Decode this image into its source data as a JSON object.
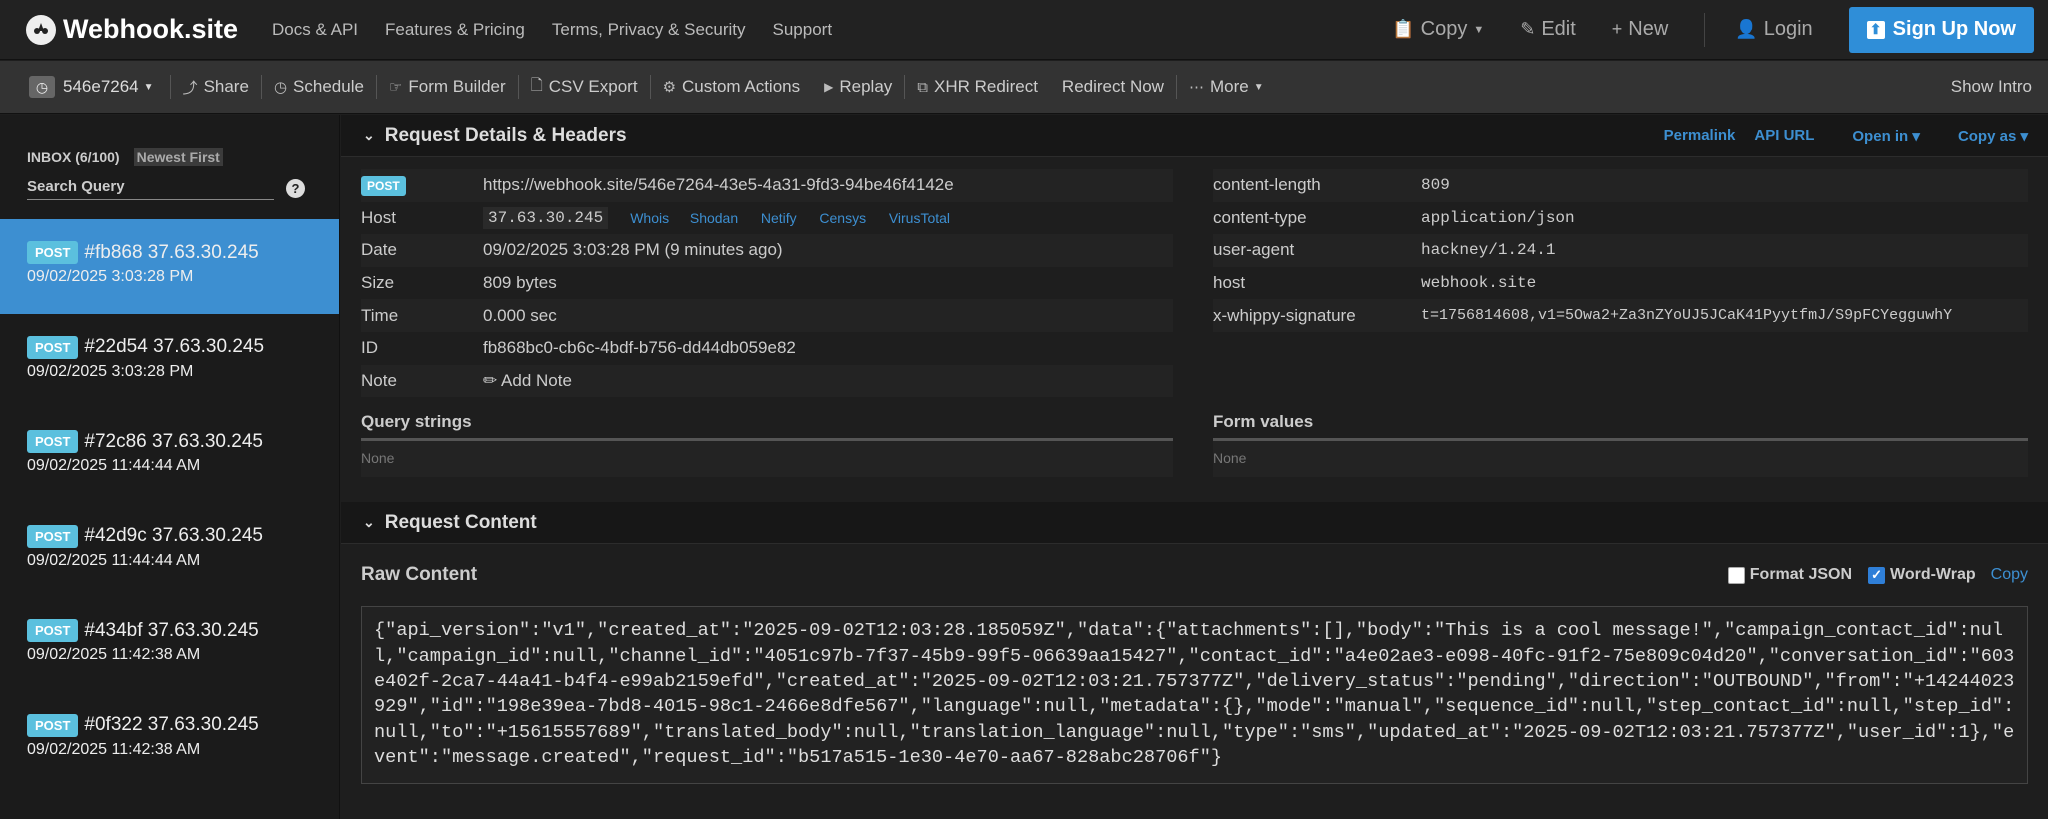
{
  "nav": {
    "brand": "Webhook.site",
    "links": [
      "Docs & API",
      "Features & Pricing",
      "Terms, Privacy & Security",
      "Support"
    ],
    "copy_label": "Copy",
    "edit_label": "Edit",
    "new_label": "New",
    "login_label": "Login",
    "signup_label": "Sign Up Now"
  },
  "toolbar": {
    "token": "546e7264",
    "share": "Share",
    "schedule": "Schedule",
    "form_builder": "Form Builder",
    "csv_export": "CSV Export",
    "custom_actions": "Custom Actions",
    "replay": "Replay",
    "xhr_redirect": "XHR Redirect",
    "redirect_now": "Redirect Now",
    "more": "More",
    "show_intro": "Show Intro"
  },
  "sidebar": {
    "inbox": "INBOX (6/100)",
    "sort": "Newest First",
    "search_placeholder": "Search Query",
    "requests": [
      {
        "method": "POST",
        "title": "#fb868 37.63.30.245",
        "time": "09/02/2025 3:03:28 PM"
      },
      {
        "method": "POST",
        "title": "#22d54 37.63.30.245",
        "time": "09/02/2025 3:03:28 PM"
      },
      {
        "method": "POST",
        "title": "#72c86 37.63.30.245",
        "time": "09/02/2025 11:44:44 AM"
      },
      {
        "method": "POST",
        "title": "#42d9c 37.63.30.245",
        "time": "09/02/2025 11:44:44 AM"
      },
      {
        "method": "POST",
        "title": "#434bf 37.63.30.245",
        "time": "09/02/2025 11:42:38 AM"
      },
      {
        "method": "POST",
        "title": "#0f322 37.63.30.245",
        "time": "09/02/2025 11:42:38 AM"
      }
    ]
  },
  "details": {
    "title": "Request Details & Headers",
    "links": {
      "permalink": "Permalink",
      "api_url": "API URL",
      "open_in": "Open in",
      "copy_as": "Copy as"
    },
    "method": "POST",
    "url": "https://webhook.site/546e7264-43e5-4a31-9fd3-94be46f4142e",
    "host_label": "Host",
    "host": "37.63.30.245",
    "host_links": [
      "Whois",
      "Shodan",
      "Netify",
      "Censys",
      "VirusTotal"
    ],
    "date_label": "Date",
    "date": "09/02/2025 3:03:28 PM (9 minutes ago)",
    "size_label": "Size",
    "size": "809 bytes",
    "time_label": "Time",
    "time": "0.000 sec",
    "id_label": "ID",
    "id": "fb868bc0-cb6c-4bdf-b756-dd44db059e82",
    "note_label": "Note",
    "add_note": "Add Note",
    "headers": [
      {
        "k": "content-length",
        "v": "809"
      },
      {
        "k": "content-type",
        "v": "application/json"
      },
      {
        "k": "user-agent",
        "v": "hackney/1.24.1"
      },
      {
        "k": "host",
        "v": "webhook.site"
      },
      {
        "k": "x-whippy-signature",
        "v": "t=1756814608,v1=5Owa2+Za3nZYoUJ5JCaK41PyytfmJ/S9pFCYegguwhY"
      }
    ],
    "query_strings": "Query strings",
    "form_values": "Form values",
    "none": "None"
  },
  "content": {
    "title": "Request Content",
    "raw_title": "Raw Content",
    "format_json": "Format JSON",
    "word_wrap": "Word-Wrap",
    "copy": "Copy",
    "raw": "{\"api_version\":\"v1\",\"created_at\":\"2025-09-02T12:03:28.185059Z\",\"data\":{\"attachments\":[],\"body\":\"This is a cool message!\",\"campaign_contact_id\":null,\"campaign_id\":null,\"channel_id\":\"4051c97b-7f37-45b9-99f5-06639aa15427\",\"contact_id\":\"a4e02ae3-e098-40fc-91f2-75e809c04d20\",\"conversation_id\":\"603e402f-2ca7-44a41-b4f4-e99ab2159efd\",\"created_at\":\"2025-09-02T12:03:21.757377Z\",\"delivery_status\":\"pending\",\"direction\":\"OUTBOUND\",\"from\":\"+14244023929\",\"id\":\"198e39ea-7bd8-4015-98c1-2466e8dfe567\",\"language\":null,\"metadata\":{},\"mode\":\"manual\",\"sequence_id\":null,\"step_contact_id\":null,\"step_id\":null,\"to\":\"+15615557689\",\"translated_body\":null,\"translation_language\":null,\"type\":\"sms\",\"updated_at\":\"2025-09-02T12:03:21.757377Z\",\"user_id\":1},\"event\":\"message.created\",\"request_id\":\"b517a515-1e30-4e70-aa67-828abc28706f\"}"
  }
}
